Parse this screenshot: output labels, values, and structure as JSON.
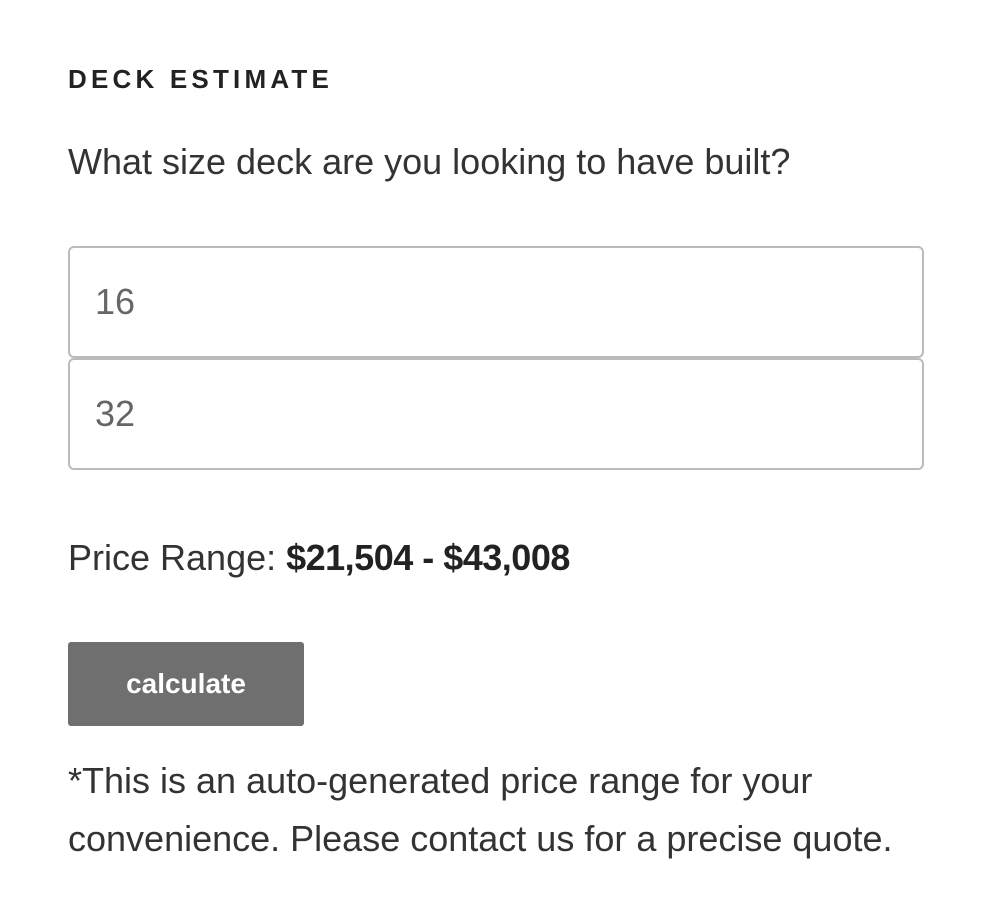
{
  "widget": {
    "title": "DECK ESTIMATE",
    "question": "What size deck are you looking to have built?",
    "length_value": "16",
    "width_value": "32",
    "price_label": "Price Range: ",
    "price_value": "$21,504 - $43,008",
    "calculate_label": "calculate",
    "disclaimer": "*This is an auto-generated price range for your convenience. Please contact us for a precise quote."
  },
  "colors": {
    "button_bg": "#6f6f6f",
    "text": "#333333",
    "input_border": "#bbbbbb"
  }
}
